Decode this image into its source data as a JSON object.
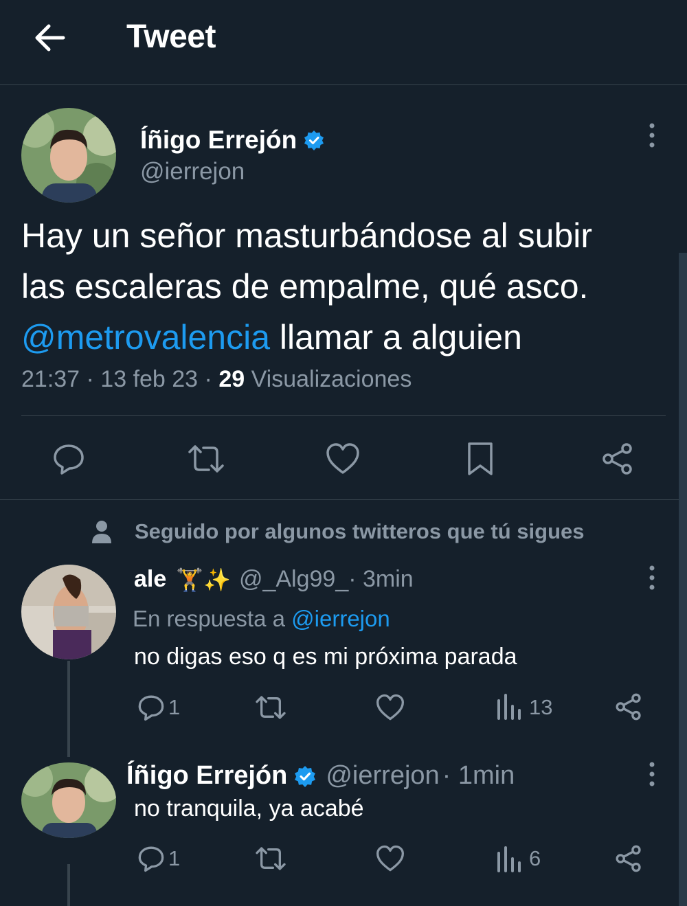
{
  "header": {
    "title": "Tweet"
  },
  "tweet": {
    "author_name": "Íñigo Errejón",
    "author_handle": "@ierrejon",
    "text_line1": "Hay un señor masturbándose al subir",
    "text_line2": "las escaleras de empalme, qué asco.",
    "mention": "@metrovalencia",
    "text_line3": " llamar a alguien",
    "time": "21:37 · 13 feb 23 · ",
    "views_count": "29",
    "views_label": " Visualizaciones"
  },
  "followed_notice": "Seguido por algunos twitteros que tú sigues",
  "replies": [
    {
      "author_name": "ale",
      "emojis": "🏋️✨",
      "handle": "@_Alg99_",
      "time": " · 3min",
      "reply_prefix": "En respuesta a ",
      "reply_to": "@ierrejon",
      "text": "no digas eso q es mi próxima parada",
      "reply_count": "1",
      "views": "13"
    },
    {
      "author_name": "Íñigo Errejón",
      "handle": "@ierrejon",
      "time": "· 1min",
      "text": "no tranquila, ya acabé",
      "reply_count": "1",
      "views": "6"
    }
  ],
  "colors": {
    "background": "#15202b",
    "accent": "#1d9bf0",
    "muted": "#8b98a5",
    "divider": "#38444d"
  }
}
